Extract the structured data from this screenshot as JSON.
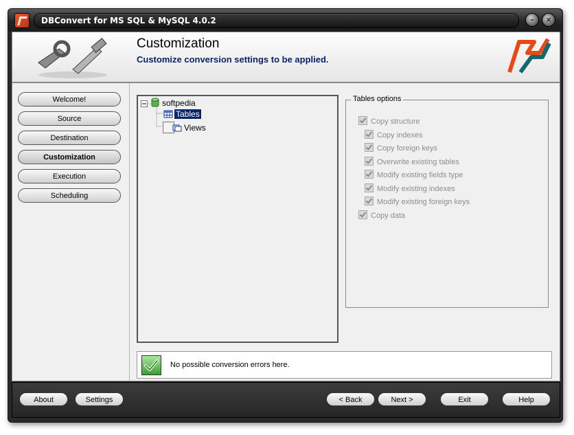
{
  "window": {
    "title": "DBConvert for MS SQL & MySQL 4.0.2"
  },
  "header": {
    "title": "Customization",
    "subtitle": "Customize conversion settings to be applied."
  },
  "nav": {
    "items": [
      {
        "label": "Welcome!"
      },
      {
        "label": "Source"
      },
      {
        "label": "Destination"
      },
      {
        "label": "Customization",
        "active": true
      },
      {
        "label": "Execution"
      },
      {
        "label": "Scheduling"
      }
    ]
  },
  "tree": {
    "root": "softpedia",
    "children": [
      {
        "label": "Tables",
        "selected": true
      },
      {
        "label": "Views",
        "selected": false
      }
    ]
  },
  "options": {
    "legend": "Tables options",
    "items": [
      {
        "label": "Copy structure",
        "checked": true
      },
      {
        "label": "Copy indexes",
        "checked": true
      },
      {
        "label": "Copy foreign keys",
        "checked": true
      },
      {
        "label": "Overwrite existing tables",
        "checked": true
      },
      {
        "label": "Modify existing fields type",
        "checked": true
      },
      {
        "label": "Modify existing indexes",
        "checked": true
      },
      {
        "label": "Modify existing foreign keys",
        "checked": true
      },
      {
        "label": "Copy data",
        "checked": true
      }
    ]
  },
  "status": {
    "message": "No possible conversion errors here."
  },
  "footer": {
    "about": "About",
    "settings": "Settings",
    "back": "< Back",
    "next": "Next >",
    "exit": "Exit",
    "help": "Help"
  },
  "colors": {
    "subtitle": "#0a1f6b",
    "status_ok": "#3aa033"
  }
}
